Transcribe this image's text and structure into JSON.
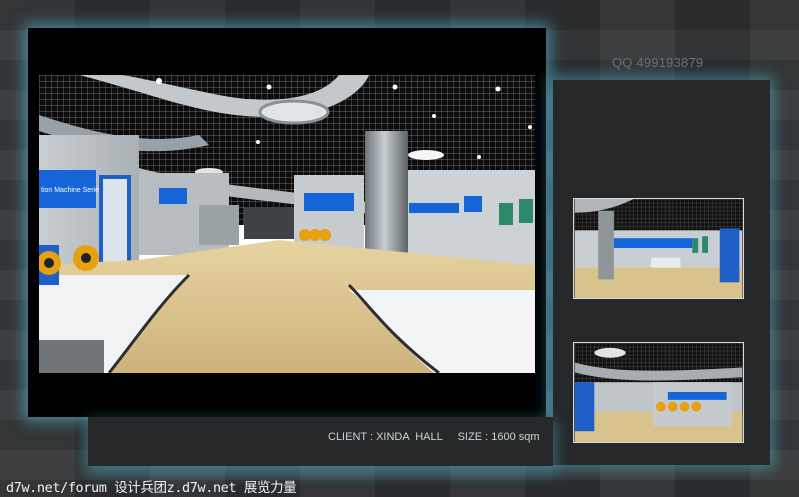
{
  "qq_text": "QQ 499193879",
  "caption": "CLIENT : XINDA  HALL     SIZE : 1600 sqm",
  "watermark": "d7w.net/forum 设计兵团z.d7w.net 展览力量",
  "main_render": {
    "wall_sign_left": "tion Machine Series"
  },
  "colors": {
    "accent_blue": "#1565d8",
    "glow": "#5ac8e6",
    "floor": "#d6bf87"
  }
}
